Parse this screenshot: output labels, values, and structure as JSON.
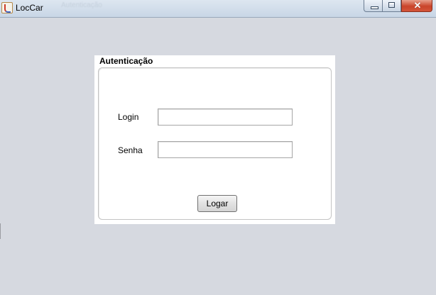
{
  "window": {
    "title": "LocCar",
    "ghost_title": "Autenticação",
    "icon": "java-cup-icon",
    "controls": {
      "minimize": "minimize-icon",
      "maximize": "maximize-icon",
      "close_glyph": "✕"
    }
  },
  "auth": {
    "title": "Autenticação",
    "login_label": "Login",
    "login_value": "",
    "password_label": "Senha",
    "password_value": "",
    "submit_label": "Logar"
  },
  "colors": {
    "window_bg": "#d6d9e0",
    "panel_bg": "#ffffff",
    "titlebar": "#c8d6e6",
    "close_button": "#c9442a"
  }
}
